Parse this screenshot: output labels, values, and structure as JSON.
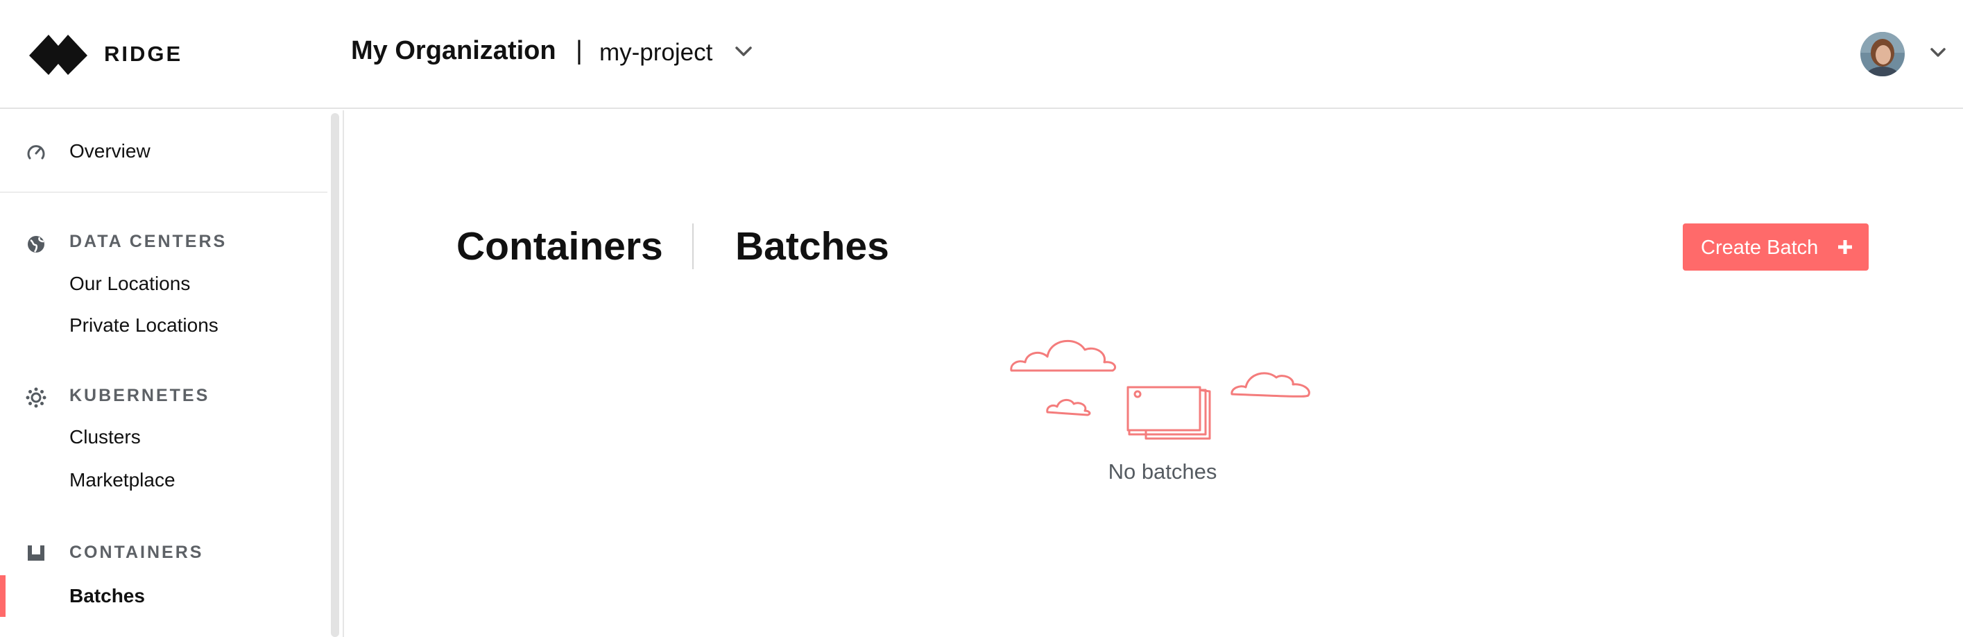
{
  "header": {
    "brand": "RIDGE",
    "organization": "My Organization",
    "separator": "|",
    "project": "my-project"
  },
  "sidebar": {
    "overview": {
      "label": "Overview",
      "icon": "speedometer-icon"
    },
    "sections": [
      {
        "label": "DATA CENTERS",
        "icon": "globe-icon",
        "items": [
          "Our Locations",
          "Private Locations"
        ]
      },
      {
        "label": "KUBERNETES",
        "icon": "kubernetes-icon",
        "items": [
          "Clusters",
          "Marketplace"
        ]
      },
      {
        "label": "CONTAINERS",
        "icon": "container-icon",
        "items": [
          "Batches"
        ]
      }
    ],
    "active_item": "Batches"
  },
  "main": {
    "tabs": [
      "Containers",
      "Batches"
    ],
    "create_button": "Create Batch",
    "empty_state": "No batches"
  },
  "colors": {
    "accent": "#ff6a6a",
    "section_label": "#5d6166",
    "border": "#e3e3e3"
  }
}
